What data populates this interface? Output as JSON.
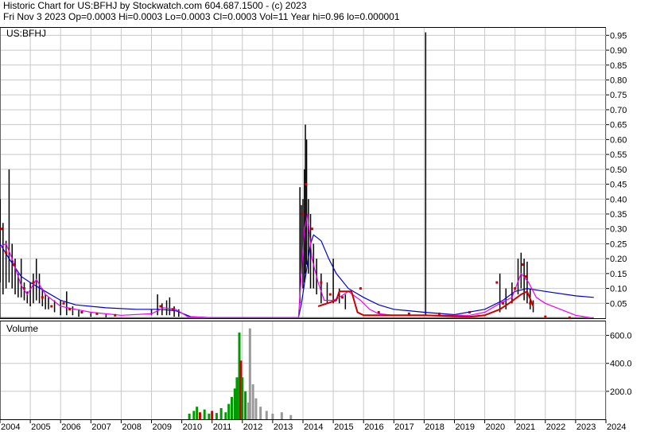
{
  "header": {
    "line1": "Historic Chart for US:BFHJ by Stockwatch.com 604.687.1500 - (c) 2023",
    "line2": "Fri Nov  3 2023   Op=0.0003   Hi=0.0003   Lo=0.0003   Cl=0.0003   Vol=11   Year hi=0.96   lo=0.000001"
  },
  "price_panel": {
    "symbol": "US:BFHJ"
  },
  "volume_panel": {
    "label": "Volume"
  },
  "colors": {
    "price_bar": "#000000",
    "close_dot": "#cc0000",
    "ma_short": "#ee00ee",
    "ma_long": "#0000cc",
    "vol_up": "#009900",
    "vol_down": "#cc0000",
    "vol_flat": "#999999",
    "grid": "#c8c8c8"
  },
  "chart_data": {
    "type": "line",
    "price": {
      "ylim": [
        0,
        0.975
      ],
      "yticks": [
        0.05,
        0.1,
        0.15,
        0.2,
        0.25,
        0.3,
        0.35,
        0.4,
        0.45,
        0.5,
        0.55,
        0.6,
        0.65,
        0.7,
        0.75,
        0.8,
        0.85,
        0.9,
        0.95
      ],
      "ytick_labels": [
        "0.05",
        "0.10",
        "0.15",
        "0.20",
        "0.25",
        "0.30",
        "0.35",
        "0.40",
        "0.45",
        "0.50",
        "0.55",
        "0.60",
        "0.65",
        "0.70",
        "0.75",
        "0.80",
        "0.85",
        "0.90",
        "0.95"
      ],
      "bars": [
        [
          2004.0,
          0.12,
          0.4
        ],
        [
          2004.1,
          0.08,
          0.32
        ],
        [
          2004.2,
          0.1,
          0.26
        ],
        [
          2004.3,
          0.12,
          0.5
        ],
        [
          2004.4,
          0.1,
          0.25
        ],
        [
          2004.5,
          0.08,
          0.2
        ],
        [
          2004.6,
          0.07,
          0.15
        ],
        [
          2004.7,
          0.07,
          0.2
        ],
        [
          2004.8,
          0.06,
          0.12
        ],
        [
          2004.9,
          0.05,
          0.09
        ],
        [
          2005.0,
          0.04,
          0.12
        ],
        [
          2005.1,
          0.05,
          0.15
        ],
        [
          2005.2,
          0.06,
          0.2
        ],
        [
          2005.3,
          0.05,
          0.15
        ],
        [
          2005.4,
          0.04,
          0.1
        ],
        [
          2005.5,
          0.03,
          0.08
        ],
        [
          2005.6,
          0.03,
          0.07
        ],
        [
          2005.8,
          0.02,
          0.06
        ],
        [
          2006.0,
          0.01,
          0.06
        ],
        [
          2006.2,
          0.01,
          0.09
        ],
        [
          2006.4,
          0.01,
          0.04
        ],
        [
          2006.6,
          0.005,
          0.03
        ],
        [
          2007.0,
          0.005,
          0.02
        ],
        [
          2007.5,
          0.003,
          0.015
        ],
        [
          2009.0,
          0.01,
          0.03
        ],
        [
          2009.2,
          0.01,
          0.08
        ],
        [
          2009.35,
          0.01,
          0.05
        ],
        [
          2009.5,
          0.01,
          0.06
        ],
        [
          2009.6,
          0.01,
          0.07
        ],
        [
          2009.75,
          0.005,
          0.04
        ],
        [
          2009.9,
          0.005,
          0.03
        ],
        [
          2013.9,
          0.05,
          0.44
        ],
        [
          2013.95,
          0.15,
          0.38
        ],
        [
          2014.0,
          0.1,
          0.4
        ],
        [
          2014.05,
          0.12,
          0.5
        ],
        [
          2014.08,
          0.15,
          0.65
        ],
        [
          2014.12,
          0.18,
          0.6
        ],
        [
          2014.18,
          0.15,
          0.4
        ],
        [
          2014.25,
          0.1,
          0.35
        ],
        [
          2014.35,
          0.1,
          0.25
        ],
        [
          2014.45,
          0.08,
          0.2
        ],
        [
          2014.6,
          0.05,
          0.15
        ],
        [
          2014.8,
          0.05,
          0.12
        ],
        [
          2015.0,
          0.05,
          0.2
        ],
        [
          2015.2,
          0.05,
          0.1
        ],
        [
          2015.4,
          0.03,
          0.08
        ],
        [
          2018.05,
          0.01,
          0.96
        ],
        [
          2020.5,
          0.02,
          0.15
        ],
        [
          2020.7,
          0.03,
          0.1
        ],
        [
          2020.9,
          0.05,
          0.12
        ],
        [
          2021.1,
          0.08,
          0.2
        ],
        [
          2021.2,
          0.1,
          0.22
        ],
        [
          2021.3,
          0.06,
          0.2
        ],
        [
          2021.4,
          0.05,
          0.19
        ],
        [
          2021.5,
          0.03,
          0.1
        ],
        [
          2021.6,
          0.02,
          0.06
        ]
      ],
      "ma_short": [
        [
          2004.0,
          0.24
        ],
        [
          2004.2,
          0.25
        ],
        [
          2004.4,
          0.2
        ],
        [
          2004.7,
          0.11
        ],
        [
          2004.9,
          0.08
        ],
        [
          2005.2,
          0.13
        ],
        [
          2005.5,
          0.08
        ],
        [
          2006.0,
          0.04
        ],
        [
          2006.5,
          0.03
        ],
        [
          2007.0,
          0.02
        ],
        [
          2008.0,
          0.01
        ],
        [
          2009.0,
          0.015
        ],
        [
          2009.4,
          0.035
        ],
        [
          2009.8,
          0.03
        ],
        [
          2010.2,
          0.005
        ],
        [
          2011.0,
          0.002
        ],
        [
          2013.85,
          0.002
        ],
        [
          2013.95,
          0.15
        ],
        [
          2014.05,
          0.3
        ],
        [
          2014.15,
          0.35
        ],
        [
          2014.3,
          0.2
        ],
        [
          2014.5,
          0.12
        ],
        [
          2014.7,
          0.06
        ],
        [
          2015.0,
          0.06
        ],
        [
          2015.2,
          0.07
        ],
        [
          2015.5,
          0.09
        ],
        [
          2015.9,
          0.06
        ],
        [
          2016.2,
          0.03
        ],
        [
          2016.5,
          0.015
        ],
        [
          2017.0,
          0.01
        ],
        [
          2018.0,
          0.01
        ],
        [
          2019.0,
          0.01
        ],
        [
          2019.5,
          0.01
        ],
        [
          2020.0,
          0.02
        ],
        [
          2020.5,
          0.05
        ],
        [
          2020.9,
          0.07
        ],
        [
          2021.2,
          0.15
        ],
        [
          2021.45,
          0.12
        ],
        [
          2021.7,
          0.07
        ],
        [
          2022.0,
          0.05
        ],
        [
          2022.5,
          0.03
        ],
        [
          2023.0,
          0.01
        ],
        [
          2023.5,
          0.002
        ]
      ],
      "ma_long": [
        [
          2004.0,
          0.25
        ],
        [
          2004.3,
          0.2
        ],
        [
          2004.7,
          0.14
        ],
        [
          2005.0,
          0.12
        ],
        [
          2005.5,
          0.09
        ],
        [
          2006.0,
          0.06
        ],
        [
          2006.5,
          0.045
        ],
        [
          2007.5,
          0.035
        ],
        [
          2008.5,
          0.03
        ],
        [
          2009.3,
          0.03
        ],
        [
          2009.8,
          0.025
        ],
        [
          2010.3,
          0.005
        ],
        [
          2011.0,
          0.002
        ],
        [
          2013.85,
          0.002
        ],
        [
          2013.95,
          0.05
        ],
        [
          2014.1,
          0.15
        ],
        [
          2014.25,
          0.25
        ],
        [
          2014.35,
          0.28
        ],
        [
          2014.6,
          0.26
        ],
        [
          2014.85,
          0.2
        ],
        [
          2015.1,
          0.15
        ],
        [
          2015.5,
          0.1
        ],
        [
          2016.0,
          0.07
        ],
        [
          2016.5,
          0.045
        ],
        [
          2017.0,
          0.03
        ],
        [
          2018.0,
          0.02
        ],
        [
          2019.0,
          0.012
        ],
        [
          2020.0,
          0.03
        ],
        [
          2020.6,
          0.06
        ],
        [
          2021.0,
          0.09
        ],
        [
          2021.4,
          0.1
        ],
        [
          2022.0,
          0.09
        ],
        [
          2023.0,
          0.075
        ],
        [
          2023.6,
          0.07
        ]
      ],
      "close_line": [
        [
          2014.5,
          0.04
        ],
        [
          2014.8,
          0.05
        ],
        [
          2015.1,
          0.06
        ],
        [
          2015.2,
          0.09
        ],
        [
          2015.6,
          0.09
        ],
        [
          2015.8,
          0.02
        ],
        [
          2016.0,
          0.01
        ],
        [
          2017.0,
          0.01
        ],
        [
          2018.0,
          0.01
        ],
        [
          2019.5,
          0.005
        ],
        [
          2020.0,
          0.01
        ],
        [
          2020.5,
          0.03
        ],
        [
          2020.8,
          0.05
        ],
        [
          2021.2,
          0.08
        ],
        [
          2021.4,
          0.09
        ],
        [
          2021.6,
          0.04
        ]
      ],
      "close_dots": [
        [
          2004.05,
          0.3
        ],
        [
          2004.2,
          0.22
        ],
        [
          2004.45,
          0.18
        ],
        [
          2004.8,
          0.1
        ],
        [
          2005.1,
          0.12
        ],
        [
          2005.4,
          0.07
        ],
        [
          2005.7,
          0.04
        ],
        [
          2006.1,
          0.05
        ],
        [
          2006.3,
          0.03
        ],
        [
          2006.7,
          0.02
        ],
        [
          2007.2,
          0.015
        ],
        [
          2007.8,
          0.01
        ],
        [
          2009.3,
          0.04
        ],
        [
          2009.7,
          0.03
        ],
        [
          2014.0,
          0.35
        ],
        [
          2014.1,
          0.45
        ],
        [
          2014.3,
          0.3
        ],
        [
          2014.6,
          0.12
        ],
        [
          2014.9,
          0.08
        ],
        [
          2015.3,
          0.07
        ],
        [
          2015.9,
          0.1
        ],
        [
          2016.5,
          0.02
        ],
        [
          2017.5,
          0.015
        ],
        [
          2018.5,
          0.015
        ],
        [
          2019.5,
          0.02
        ],
        [
          2020.4,
          0.12
        ],
        [
          2020.6,
          0.05
        ],
        [
          2021.0,
          0.1
        ],
        [
          2021.25,
          0.18
        ],
        [
          2021.35,
          0.14
        ],
        [
          2021.5,
          0.05
        ],
        [
          2022.0,
          0.005
        ],
        [
          2022.8,
          0.002
        ]
      ]
    },
    "volume": {
      "ylim": [
        0,
        700
      ],
      "yticks": [
        200,
        400,
        600
      ],
      "ytick_labels": [
        "200.0",
        "400.0",
        "600.0"
      ],
      "bars": [
        [
          2010.25,
          40,
          "up"
        ],
        [
          2010.4,
          60,
          "up"
        ],
        [
          2010.5,
          90,
          "up"
        ],
        [
          2010.6,
          50,
          "down"
        ],
        [
          2010.75,
          70,
          "up"
        ],
        [
          2010.9,
          40,
          "up"
        ],
        [
          2011.0,
          60,
          "down"
        ],
        [
          2011.15,
          45,
          "up"
        ],
        [
          2011.3,
          80,
          "up"
        ],
        [
          2011.45,
          50,
          "up"
        ],
        [
          2011.55,
          110,
          "up"
        ],
        [
          2011.65,
          160,
          "up"
        ],
        [
          2011.75,
          220,
          "up"
        ],
        [
          2011.82,
          300,
          "up"
        ],
        [
          2011.9,
          620,
          "up"
        ],
        [
          2011.95,
          420,
          "down"
        ],
        [
          2012.0,
          300,
          "up"
        ],
        [
          2012.1,
          200,
          "up"
        ],
        [
          2012.2,
          120,
          "flat"
        ],
        [
          2012.25,
          650,
          "flat"
        ],
        [
          2012.35,
          250,
          "flat"
        ],
        [
          2012.45,
          150,
          "flat"
        ],
        [
          2012.6,
          90,
          "flat"
        ],
        [
          2012.8,
          60,
          "flat"
        ],
        [
          2013.0,
          40,
          "flat"
        ],
        [
          2013.3,
          50,
          "flat"
        ],
        [
          2013.6,
          30,
          "flat"
        ]
      ]
    },
    "x": {
      "range": [
        2004,
        2024
      ],
      "ticks": [
        2004,
        2005,
        2006,
        2007,
        2008,
        2009,
        2010,
        2011,
        2012,
        2013,
        2014,
        2015,
        2016,
        2017,
        2018,
        2019,
        2020,
        2021,
        2022,
        2023,
        2024
      ],
      "tick_labels": [
        "2004",
        "2005",
        "2006",
        "2007",
        "2008",
        "2009",
        "2010",
        "2011",
        "2012",
        "2013",
        "2014",
        "2015",
        "2016",
        "2017",
        "2018",
        "2019",
        "2020",
        "2021",
        "2022",
        "2023",
        "2024"
      ]
    }
  }
}
